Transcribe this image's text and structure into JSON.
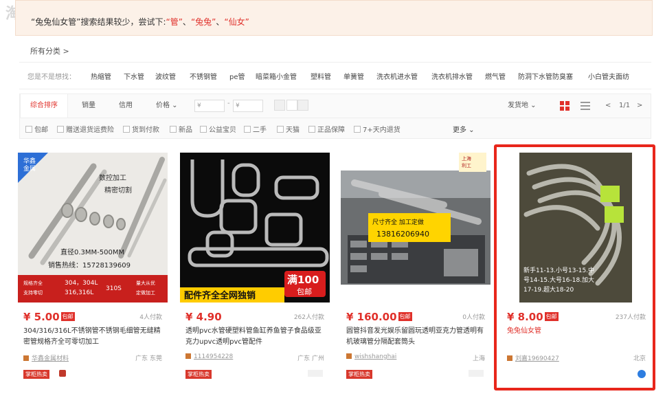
{
  "notice": {
    "query": "“兔兔仙女管”",
    "message": "搜索结果较少，尝试下:",
    "suggestions": [
      "“管”",
      "“兔兔”",
      "“仙女”"
    ],
    "sep": "、"
  },
  "all_categories": "所有分类 >",
  "categories": {
    "hint": "您是不是想找：",
    "items": [
      "热缩管",
      "下水管",
      "波纹管",
      "不锈钢管",
      "pe管",
      "暗菜箱小金管",
      "塑料管",
      "单簧管",
      "洗衣机进水管",
      "洗衣机排水管",
      "燃气管",
      "防洞下水管防臭塞",
      "小白管夫面纺"
    ]
  },
  "sort": {
    "tabs": [
      "综合排序",
      "销量",
      "信用",
      "价格 ⌄"
    ],
    "price_from": "¥",
    "price_to": "¥",
    "dash": "-",
    "ship_from": "发货地 ⌄",
    "page": "1/1",
    "prev": "<",
    "next": ">"
  },
  "options": {
    "items": [
      "包邮",
      "赠送退货运费险",
      "货到付款",
      "新品",
      "公益宝贝",
      "二手",
      "天猫",
      "正品保障",
      "7+天内退货"
    ],
    "more": "更多 ⌄"
  },
  "products": [
    {
      "price": "¥ 5.00",
      "badge": "包邮",
      "sales": "4人付款",
      "title": "304/316/316L不锈钢管不锈钢毛细管无缝精密管规格齐全可零切加工",
      "shop": "华鑫金属材料",
      "region": "广东 东莞",
      "tag": "掌柜热卖",
      "image": {
        "corner": "华鑫\n金属",
        "label1": "数控加工",
        "label2": "精密切割",
        "spec": "直径0.3MM-500MM",
        "phone": "销售热线：15728139609",
        "s1": "规格齐全",
        "s2": "支持零切",
        "m1": "304，304L",
        "m2": "316,316L",
        "m3": "310S",
        "r1": "量大从优",
        "r2": "定做加工"
      }
    },
    {
      "price": "¥ 4.90",
      "badge": "",
      "sales": "262人付款",
      "title": "透明pvc水管硬塑料管鱼缸养鱼管子食品级亚克力upvc透明pvc管配件",
      "shop": "1114954228",
      "region": "广东 广州",
      "tag": "掌柜热卖",
      "image": {
        "banner": "配件齐全全网独销",
        "bubble1": "满100",
        "bubble2": "包邮"
      }
    },
    {
      "price": "¥ 160.00",
      "badge": "包邮",
      "sales": "0人付款",
      "title": "圆管抖音发光娱乐留圆玩透明亚克力管透明有机玻璃管分隔配套筒头",
      "shop": "wishshanghai",
      "region": "上海",
      "tag": "掌柜热卖",
      "image": {
        "sign": "上海\n利工",
        "yellow1": "尺寸齐全 加工定做",
        "yellow2": "13816206940"
      }
    },
    {
      "price": "¥ 8.00",
      "badge": "包邮",
      "sales": "237人付款",
      "title": "兔兔仙女管",
      "shop": "刘嘉19690427",
      "region": "北京",
      "tag": "",
      "image": {
        "t1": "新手11-13.小号13-15.中",
        "t2": "号14-15.大号16-18.加大",
        "t3": "17-19.超大18-20"
      }
    }
  ],
  "colors": {
    "accent": "#e0302a",
    "highlight": "#e8261b",
    "notice_bg": "#fcf1e8"
  }
}
